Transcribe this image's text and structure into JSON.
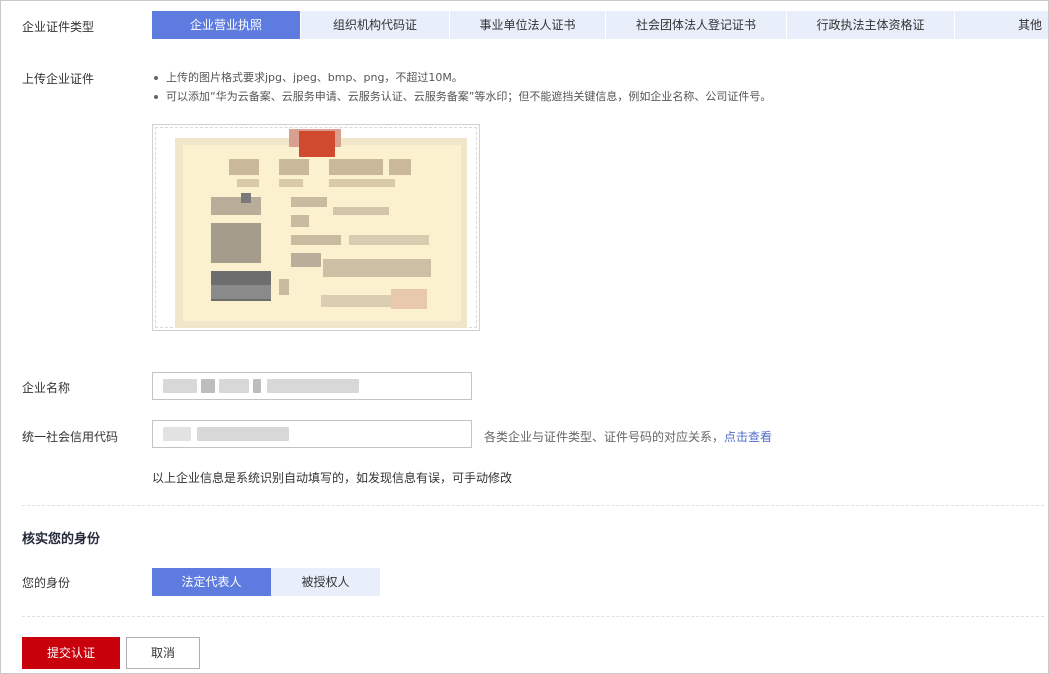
{
  "cert_type": {
    "label": "企业证件类型",
    "tabs": [
      {
        "label": "企业营业执照",
        "active": true
      },
      {
        "label": "组织机构代码证",
        "active": false
      },
      {
        "label": "事业单位法人证书",
        "active": false
      },
      {
        "label": "社会团体法人登记证书",
        "active": false
      },
      {
        "label": "行政执法主体资格证",
        "active": false
      },
      {
        "label": "其他",
        "active": false
      }
    ]
  },
  "upload": {
    "label": "上传企业证件",
    "hints": [
      "上传的图片格式要求jpg、jpeg、bmp、png，不超过10M。",
      "可以添加“华为云备案、云服务申请、云服务认证、云服务备案”等水印；但不能遮挡关键信息，例如企业名称、公司证件号。"
    ]
  },
  "company_name": {
    "label": "企业名称"
  },
  "credit_code": {
    "label": "统一社会信用代码",
    "hint": "各类企业与证件类型、证件号码的对应关系，",
    "hint_link": "点击查看"
  },
  "auto_fill_note": "以上企业信息是系统识别自动填写的，如发现信息有误，可手动修改",
  "identity": {
    "section_title": "核实您的身份",
    "label": "您的身份",
    "options": [
      {
        "label": "法定代表人",
        "active": true
      },
      {
        "label": "被授权人",
        "active": false
      }
    ]
  },
  "actions": {
    "submit": "提交认证",
    "cancel": "取消"
  },
  "colors": {
    "accent": "#5e7ce0",
    "tab_bg": "#e9eefb",
    "primary_button": "#c7000b",
    "link": "#526ecc"
  }
}
